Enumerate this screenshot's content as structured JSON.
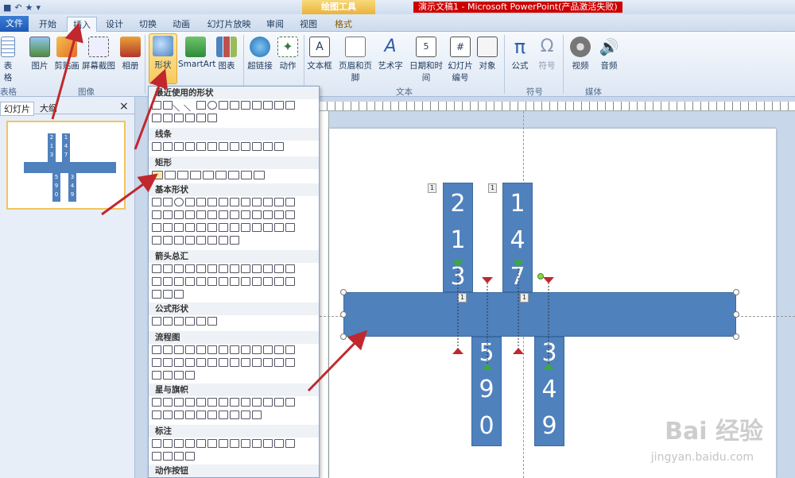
{
  "titlebar": {
    "context_tools": "绘图工具",
    "window_title": "演示文稿1 - Microsoft PowerPoint(产品激活失败)"
  },
  "tabs": [
    {
      "label": "文件"
    },
    {
      "label": "开始"
    },
    {
      "label": "插入"
    },
    {
      "label": "设计"
    },
    {
      "label": "切换"
    },
    {
      "label": "动画"
    },
    {
      "label": "幻灯片放映"
    },
    {
      "label": "审阅"
    },
    {
      "label": "视图"
    },
    {
      "label": "格式"
    }
  ],
  "ribbon": {
    "buttons": {
      "table": "表格",
      "picture": "图片",
      "clipart": "剪贴画",
      "screenshot": "屏幕截图",
      "album": "相册",
      "shapes": "形状",
      "smartart": "SmartArt",
      "chart": "图表",
      "hyperlink": "超链接",
      "action": "动作",
      "textbox": "文本框",
      "header_footer": "页眉和页脚",
      "wordart": "艺术字",
      "datetime": "日期和时间",
      "slide_number_1": "幻灯片",
      "slide_number_2": "编号",
      "object": "对象",
      "equation": "公式",
      "symbol": "符号",
      "video": "视频",
      "audio": "音频"
    },
    "groups": {
      "tables": "表格",
      "images": "图像",
      "text": "文本",
      "symbols": "符号",
      "media": "媒体"
    }
  },
  "left_panel": {
    "tab_slides": "幻灯片",
    "tab_outline": "大纲",
    "close": "×"
  },
  "gallery": {
    "sections": [
      "最近使用的形状",
      "线条",
      "矩形",
      "基本形状",
      "箭头总汇",
      "公式形状",
      "流程图",
      "星与旗帜",
      "标注",
      "动作按钮"
    ]
  },
  "slide": {
    "col1": [
      "2",
      "1",
      "3"
    ],
    "col2": [
      "1",
      "4",
      "7"
    ],
    "col3": [
      "5",
      "9",
      "0"
    ],
    "col4": [
      "3",
      "4",
      "9"
    ],
    "badge": "1"
  },
  "thumb": {
    "col1": [
      "2",
      "1",
      "3"
    ],
    "col2": [
      "1",
      "4",
      "7"
    ],
    "col3": [
      "5",
      "9",
      "0"
    ],
    "col4": [
      "3",
      "4",
      "9"
    ]
  },
  "watermark": {
    "brand": "Bai 经验",
    "url": "jingyan.baidu.com"
  },
  "colors": {
    "shape_fill": "#4f81bd",
    "arrow_red": "#c0282d",
    "highlight": "#f8c95c"
  }
}
